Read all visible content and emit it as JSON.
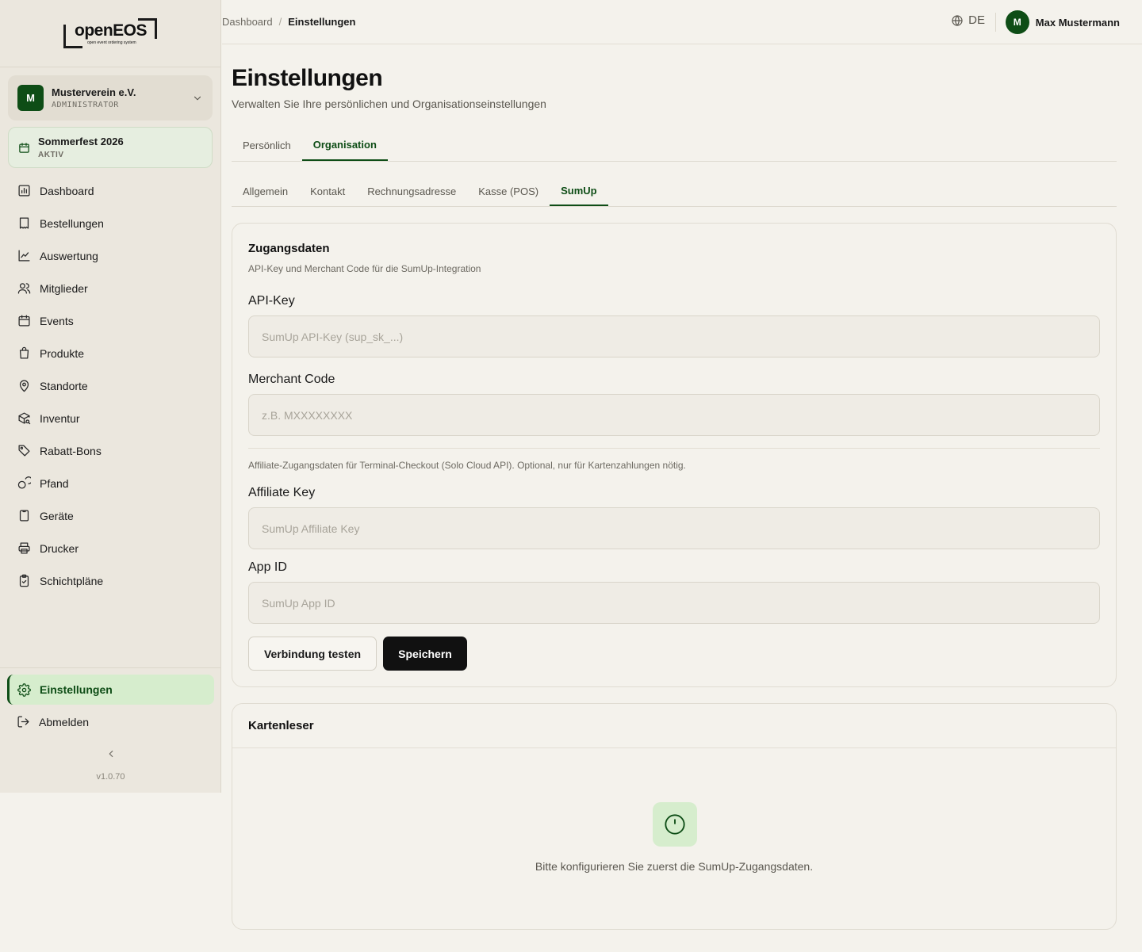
{
  "logo": {
    "text": "openEOS",
    "tagline": "open event ordering system"
  },
  "org": {
    "initial": "M",
    "name": "Musterverein e.V.",
    "role": "ADMINISTRATOR"
  },
  "event": {
    "name": "Sommerfest 2026",
    "status": "AKTIV"
  },
  "nav": {
    "items": [
      {
        "label": "Dashboard",
        "icon": "bar-chart-icon"
      },
      {
        "label": "Bestellungen",
        "icon": "receipt-icon"
      },
      {
        "label": "Auswertung",
        "icon": "trend-line-icon"
      },
      {
        "label": "Mitglieder",
        "icon": "users-icon"
      },
      {
        "label": "Events",
        "icon": "calendar-icon"
      },
      {
        "label": "Produkte",
        "icon": "shopping-bag-icon"
      },
      {
        "label": "Standorte",
        "icon": "map-pin-icon"
      },
      {
        "label": "Inventur",
        "icon": "package-search-icon"
      },
      {
        "label": "Rabatt-Bons",
        "icon": "tag-icon"
      },
      {
        "label": "Pfand",
        "icon": "coins-icon"
      },
      {
        "label": "Geräte",
        "icon": "tablet-icon"
      },
      {
        "label": "Drucker",
        "icon": "printer-icon"
      },
      {
        "label": "Schichtpläne",
        "icon": "clipboard-check-icon"
      }
    ],
    "settings": "Einstellungen",
    "logout": "Abmelden"
  },
  "version": "v1.0.70",
  "breadcrumb": {
    "root": "Dashboard",
    "separator": "/",
    "current": "Einstellungen"
  },
  "language": "DE",
  "user": {
    "initial": "M",
    "name": "Max Mustermann"
  },
  "page": {
    "title": "Einstellungen",
    "subtitle": "Verwalten Sie Ihre persönlichen und Organisationseinstellungen"
  },
  "tabs": [
    "Persönlich",
    "Organisation"
  ],
  "subtabs": [
    "Allgemein",
    "Kontakt",
    "Rechnungsadresse",
    "Kasse (POS)",
    "SumUp"
  ],
  "credentials": {
    "title": "Zugangsdaten",
    "description": "API-Key und Merchant Code für die SumUp-Integration",
    "api_key": {
      "label": "API-Key",
      "placeholder": "SumUp API-Key (sup_sk_...)",
      "value": ""
    },
    "merchant_code": {
      "label": "Merchant Code",
      "placeholder": "z.B. MXXXXXXXX",
      "value": ""
    },
    "affiliate_hint": "Affiliate-Zugangsdaten für Terminal-Checkout (Solo Cloud API). Optional, nur für Kartenzahlungen nötig.",
    "affiliate_key": {
      "label": "Affiliate Key",
      "placeholder": "SumUp Affiliate Key",
      "value": ""
    },
    "app_id": {
      "label": "App ID",
      "placeholder": "SumUp App ID",
      "value": ""
    },
    "test_button": "Verbindung testen",
    "save_button": "Speichern"
  },
  "card_readers": {
    "title": "Kartenleser",
    "empty_message": "Bitte konfigurieren Sie zuerst die SumUp-Zugangsdaten."
  },
  "colors": {
    "accent": "#0e4d16",
    "accent_light": "#d6edcd",
    "background": "#f4f2ec",
    "sidebar": "#ebe7de"
  }
}
